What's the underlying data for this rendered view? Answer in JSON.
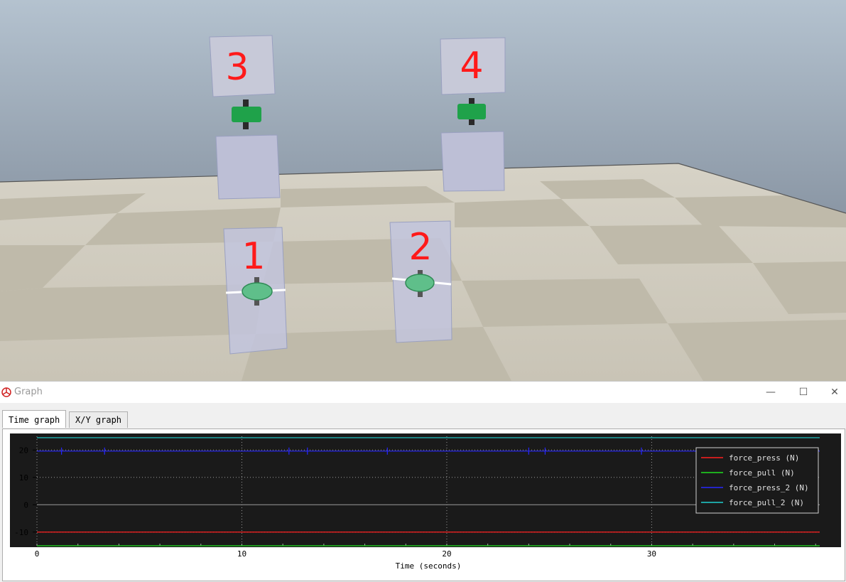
{
  "scene": {
    "labels": [
      "1",
      "2",
      "3",
      "4"
    ]
  },
  "graph_window": {
    "title": "Graph",
    "minimize_glyph": "—",
    "maximize_glyph": "☐",
    "close_glyph": "✕",
    "tabs": [
      {
        "label": "Time graph",
        "active": true
      },
      {
        "label": "X/Y graph",
        "active": false
      }
    ]
  },
  "colors": {
    "plot_bg": "#1a1a1a",
    "force_press": "#ff2020",
    "force_pull": "#20e020",
    "force_press_2": "#2828ff",
    "force_pull_2": "#20d0d0"
  },
  "chart_data": {
    "type": "line",
    "xlabel": "Time (seconds)",
    "ylabel": "",
    "xlim": [
      0,
      38.2
    ],
    "ylim": [
      -15,
      25
    ],
    "x_ticks": [
      0,
      10,
      20,
      30
    ],
    "y_ticks": [
      20,
      10,
      0,
      -10
    ],
    "grid": true,
    "legend_position": "top-right",
    "series": [
      {
        "name": "force_press (N)",
        "color": "#ff2020",
        "x": [
          0,
          38.2
        ],
        "y": [
          -10,
          -10
        ]
      },
      {
        "name": "force_pull (N)",
        "color": "#20e020",
        "x": [
          0,
          38.2
        ],
        "y": [
          -15,
          -15
        ]
      },
      {
        "name": "force_press_2 (N)",
        "color": "#2828ff",
        "x": [
          0,
          38.2
        ],
        "y": [
          19.6,
          19.6
        ],
        "spikes_at": [
          1.2,
          3.3,
          12.3,
          13.2,
          17.1,
          24.0,
          24.8,
          29.5
        ]
      },
      {
        "name": "force_pull_2 (N)",
        "color": "#20d0d0",
        "x": [
          0,
          38.2
        ],
        "y": [
          24.5,
          24.5
        ]
      }
    ]
  }
}
